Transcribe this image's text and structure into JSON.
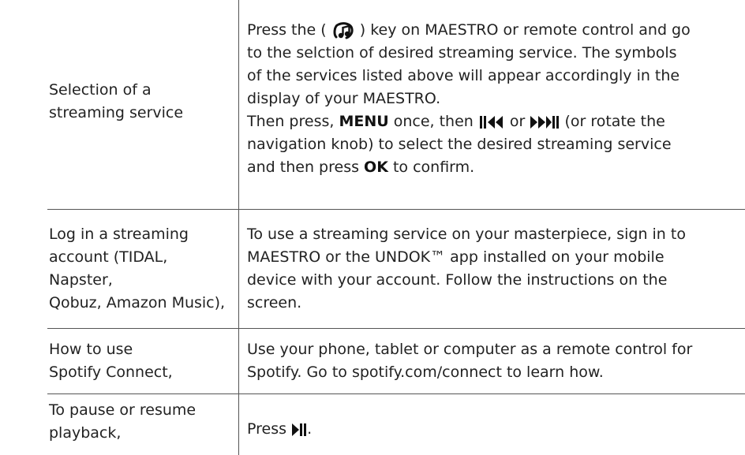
{
  "rows": [
    {
      "left": [
        "Selection of a",
        "streaming service"
      ],
      "right": {
        "p1_a": "Press the (",
        "p1_b": ") key on MAESTRO or remote control and go",
        "p2": "to the selction of desired streaming service. The symbols",
        "p3": "of the services listed above will appear accordingly in the",
        "p4": "display of your MAESTRO.",
        "p5_a": "Then press,",
        "p5_menu": "MENU",
        "p5_b": "once, then",
        "p5_or": "or",
        "p5_c": "(or rotate the",
        "p6": "navigation knob) to select the desired streaming service",
        "p7_a": "and then press",
        "p7_ok": "OK",
        "p7_b": "to confirm."
      }
    },
    {
      "left": [
        "Log in a streaming",
        "account (TIDAL, Napster,",
        "Qobuz, Amazon Music),"
      ],
      "right": [
        "To use a streaming service on your masterpiece, sign in to",
        "MAESTRO or the UNDOK™ app installed on your mobile",
        "device with your account. Follow the instructions on the",
        "screen."
      ]
    },
    {
      "left": [
        "How to use",
        "Spotify Connect,"
      ],
      "right": [
        "Use your phone, tablet or computer as a remote control for",
        "Spotify. Go to spotify.com/connect to learn how."
      ]
    },
    {
      "left": [
        "To pause or resume",
        "playback,"
      ],
      "right": {
        "a": "Press",
        "b": "."
      }
    }
  ],
  "icons": {
    "streaming": "streaming-music-icon",
    "skip_back": "skip-back-icon",
    "skip_forward": "skip-forward-play-pause-icon",
    "play_pause": "play-pause-icon"
  }
}
